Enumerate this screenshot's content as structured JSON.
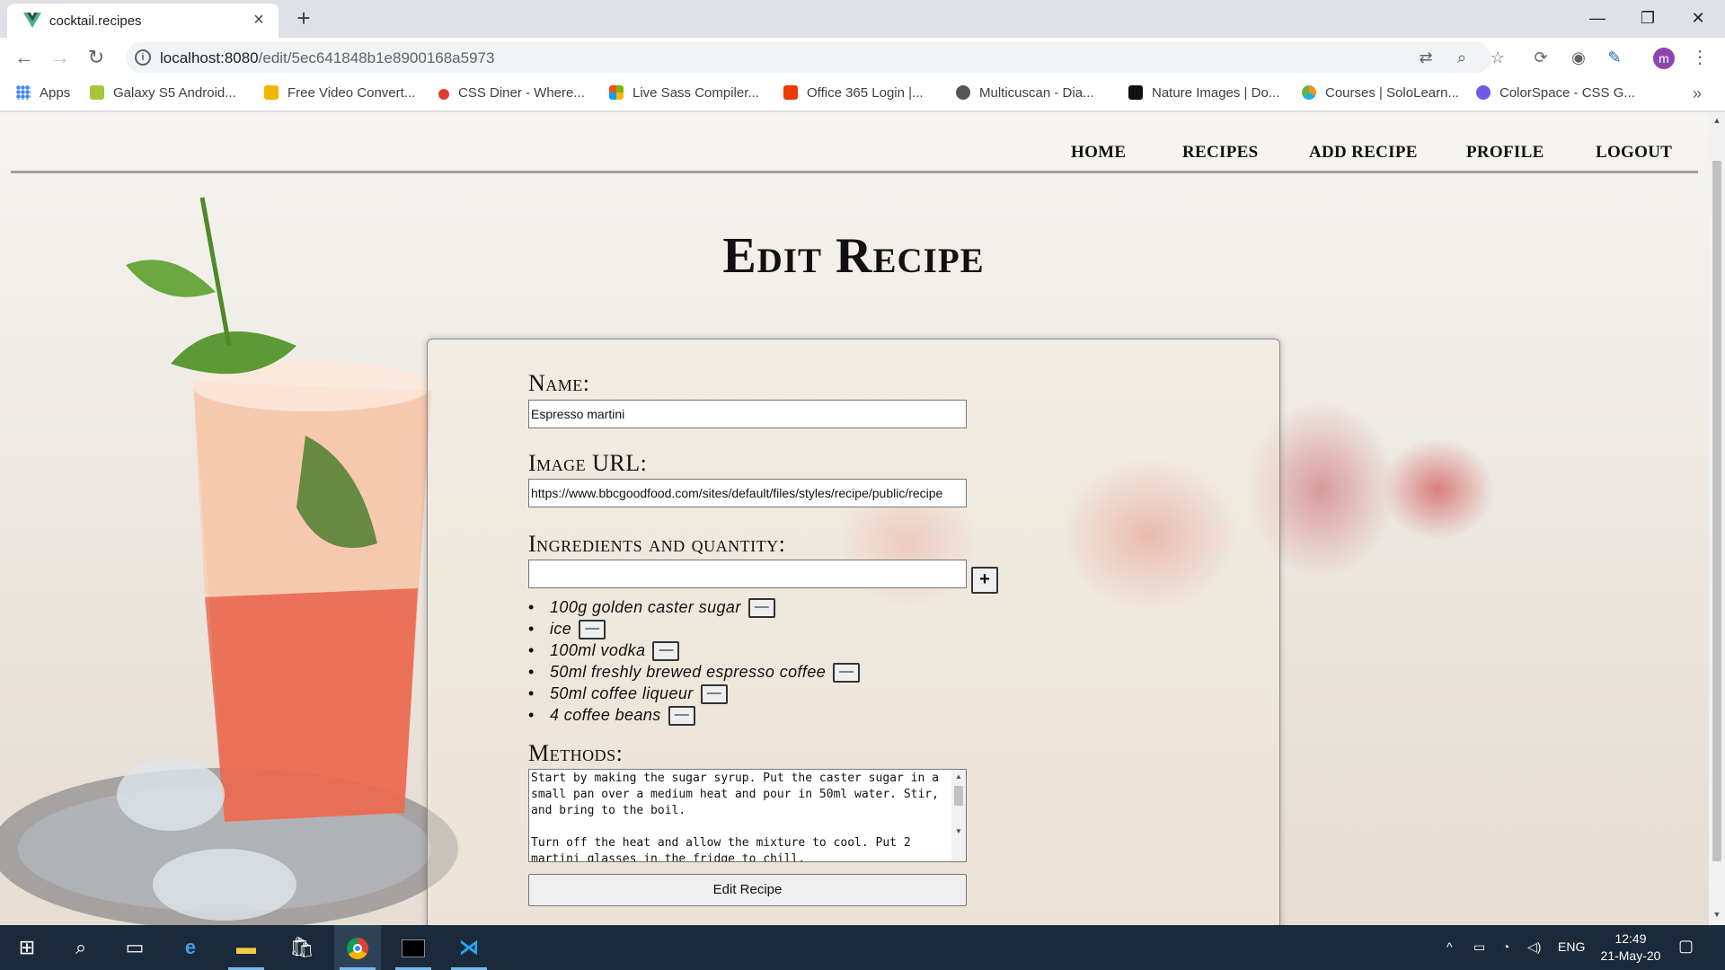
{
  "browser": {
    "tab_title": "cocktail.recipes",
    "url_host": "localhost:8080",
    "url_path": "/edit/5ec641848b1e8900168a5973",
    "profile_initial": "m",
    "bookmarks": [
      {
        "label": "Apps",
        "icon": "apps-grid-icon",
        "color": "#4285f4"
      },
      {
        "label": "Galaxy S5 Android...",
        "icon": "android-icon",
        "color": "#a4c639"
      },
      {
        "label": "Free Video Convert...",
        "icon": "video-convert-icon",
        "color": "#f4b400"
      },
      {
        "label": "CSS Diner - Where...",
        "icon": "css-diner-icon",
        "color": "#e53935"
      },
      {
        "label": "Live Sass Compiler...",
        "icon": "microsoft-icon",
        "color": "#00a4ef"
      },
      {
        "label": "Office 365 Login |...",
        "icon": "office-icon",
        "color": "#eb3c00"
      },
      {
        "label": "Multicuscan - Dia...",
        "icon": "globe-icon",
        "color": "#555555"
      },
      {
        "label": "Nature Images | Do...",
        "icon": "unsplash-icon",
        "color": "#111111"
      },
      {
        "label": "Courses | SoloLearn...",
        "icon": "sololearn-icon",
        "color": "#f29423"
      },
      {
        "label": "ColorSpace - CSS G...",
        "icon": "colorspace-icon",
        "color": "#6c5ce7"
      }
    ]
  },
  "nav": {
    "home": "HOME",
    "recipes": "RECIPES",
    "add_recipe": "ADD RECIPE",
    "profile": "PROFILE",
    "logout": "LOGOUT"
  },
  "page": {
    "title": "Edit Recipe"
  },
  "form": {
    "name_label": "Name:",
    "name_value": "Espresso martini",
    "image_label": "Image URL:",
    "image_value": "https://www.bbcgoodfood.com/sites/default/files/styles/recipe/public/recipe",
    "ingredients_label": "Ingredients and quantity:",
    "ingredient_input_value": "",
    "add_symbol": "+",
    "remove_symbol": "—",
    "bullet": "•",
    "ingredients": [
      "100g golden caster sugar",
      "ice",
      "100ml vodka",
      "50ml freshly brewed espresso coffee",
      "50ml coffee liqueur",
      "4 coffee beans"
    ],
    "methods_label": "Methods:",
    "methods_value": "Start by making the sugar syrup. Put the caster sugar in a small pan over a medium heat and pour in 50ml water. Stir, and bring to the boil.\n\nTurn off the heat and allow the mixture to cool. Put 2 martini glasses in the fridge to chill.",
    "submit_label": "Edit Recipe"
  },
  "taskbar": {
    "language": "ENG",
    "time": "12:49",
    "date": "21-May-20"
  }
}
